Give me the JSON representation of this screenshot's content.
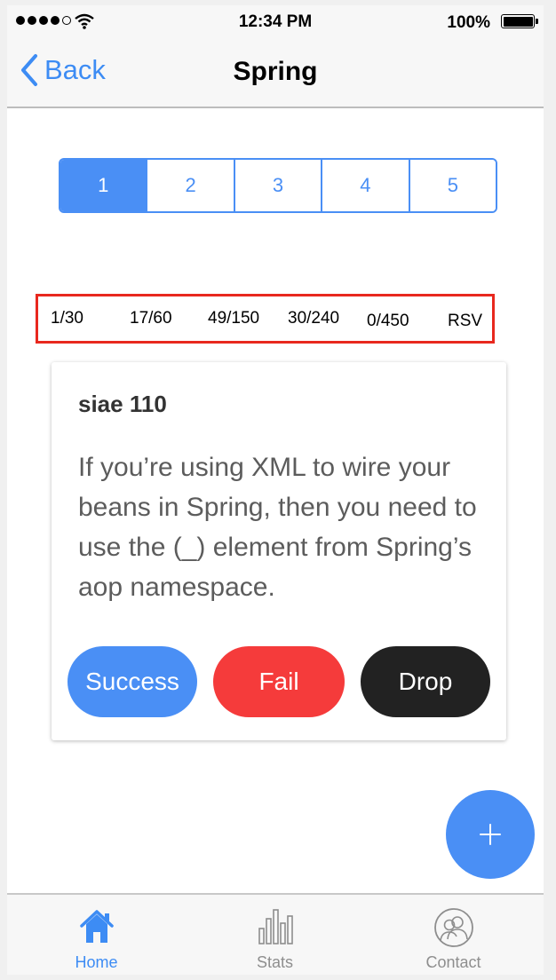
{
  "status_bar": {
    "time": "12:34 PM",
    "battery": "100%"
  },
  "nav": {
    "back_label": "Back",
    "title": "Spring"
  },
  "pagination": {
    "pages": [
      "1",
      "2",
      "3",
      "4",
      "5"
    ],
    "active": "1"
  },
  "stats": [
    "1/30",
    "17/60",
    "49/150",
    "30/240",
    "0/450",
    "RSV"
  ],
  "card": {
    "title": "siae 110",
    "question": "If you’re using XML to wire your beans in Spring, then you need to use the (_) element from Spring’s aop namespace.",
    "buttons": {
      "success": "Success",
      "fail": "Fail",
      "drop": "Drop"
    }
  },
  "fab": {
    "icon": "plus-icon"
  },
  "tab_bar": {
    "tabs": [
      {
        "label": "Home",
        "icon": "home-icon"
      },
      {
        "label": "Stats",
        "icon": "bar-chart-icon"
      },
      {
        "label": "Contact",
        "icon": "contacts-icon"
      }
    ]
  },
  "colors": {
    "accent": "#4a8ff5",
    "fail": "#f53b3b",
    "drop": "#222222",
    "highlight_border": "#e8281e"
  }
}
